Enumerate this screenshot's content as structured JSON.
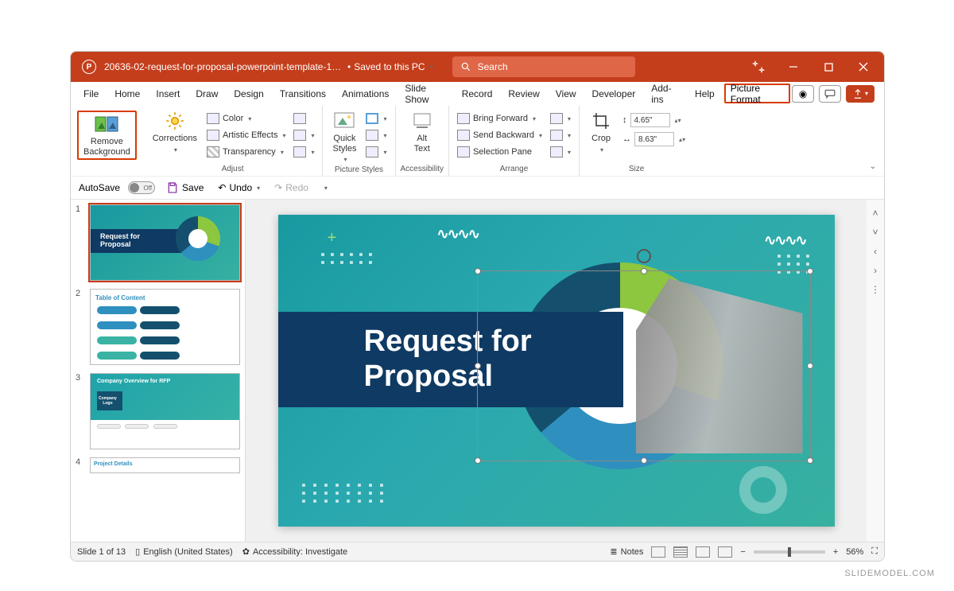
{
  "titlebar": {
    "doc_name": "20636-02-request-for-proposal-powerpoint-template-16x9...",
    "saved_label": "Saved to this PC",
    "search_placeholder": "Search"
  },
  "menu": {
    "tabs": [
      "File",
      "Home",
      "Insert",
      "Draw",
      "Design",
      "Transitions",
      "Animations",
      "Slide Show",
      "Record",
      "Review",
      "View",
      "Developer",
      "Add-ins",
      "Help",
      "Picture Format"
    ]
  },
  "ribbon": {
    "remove_bg": "Remove\nBackground",
    "corrections": "Corrections",
    "color": "Color",
    "artistic": "Artistic Effects",
    "transparency": "Transparency",
    "adjust_label": "Adjust",
    "quick_styles": "Quick\nStyles",
    "picture_styles_label": "Picture Styles",
    "alt_text": "Alt\nText",
    "accessibility_label": "Accessibility",
    "bring_forward": "Bring Forward",
    "send_backward": "Send Backward",
    "selection_pane": "Selection Pane",
    "arrange_label": "Arrange",
    "crop": "Crop",
    "height": "4.65\"",
    "width": "8.63\"",
    "size_label": "Size"
  },
  "qat": {
    "autosave": "AutoSave",
    "autosave_state": "Off",
    "save": "Save",
    "undo": "Undo",
    "redo": "Redo"
  },
  "thumbs": {
    "t1_title": "Request for\nProposal",
    "t2_title": "Table of Content",
    "t3_title": "Company Overview for RFP",
    "t3_logo": "Company\nLogo",
    "t4_title": "Project Details"
  },
  "slide": {
    "title": "Request for\nProposal"
  },
  "status": {
    "slide_count": "Slide 1 of 13",
    "language": "English (United States)",
    "accessibility": "Accessibility: Investigate",
    "notes": "Notes",
    "zoom": "56%"
  },
  "watermark": "SLIDEMODEL.COM"
}
